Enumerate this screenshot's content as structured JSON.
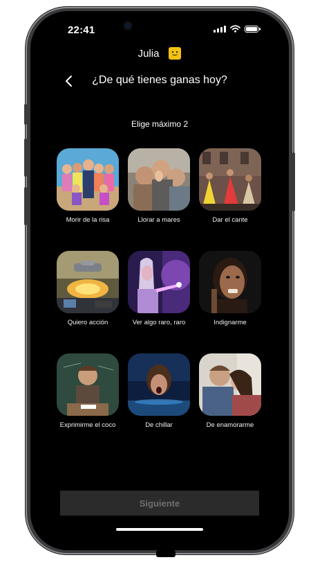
{
  "status_bar": {
    "time": "22:41"
  },
  "profile": {
    "name": "Julia"
  },
  "header": {
    "title": "¿De qué tienes ganas hoy?"
  },
  "subtitle": "Elige máximo 2",
  "moods": [
    {
      "label": "Morir de la risa"
    },
    {
      "label": "Llorar a mares"
    },
    {
      "label": "Dar el cante"
    },
    {
      "label": "Quiero acción"
    },
    {
      "label": "Ver algo raro, raro"
    },
    {
      "label": "Indignarme"
    },
    {
      "label": "Exprimirme el coco"
    },
    {
      "label": "De chillar"
    },
    {
      "label": "De enamorarme"
    }
  ],
  "footer": {
    "next_label": "Siguiente"
  },
  "colors": {
    "background": "#000000",
    "avatar": "#f5c211",
    "button_bg": "#2b2b2b",
    "button_text": "#6f6f6f"
  }
}
